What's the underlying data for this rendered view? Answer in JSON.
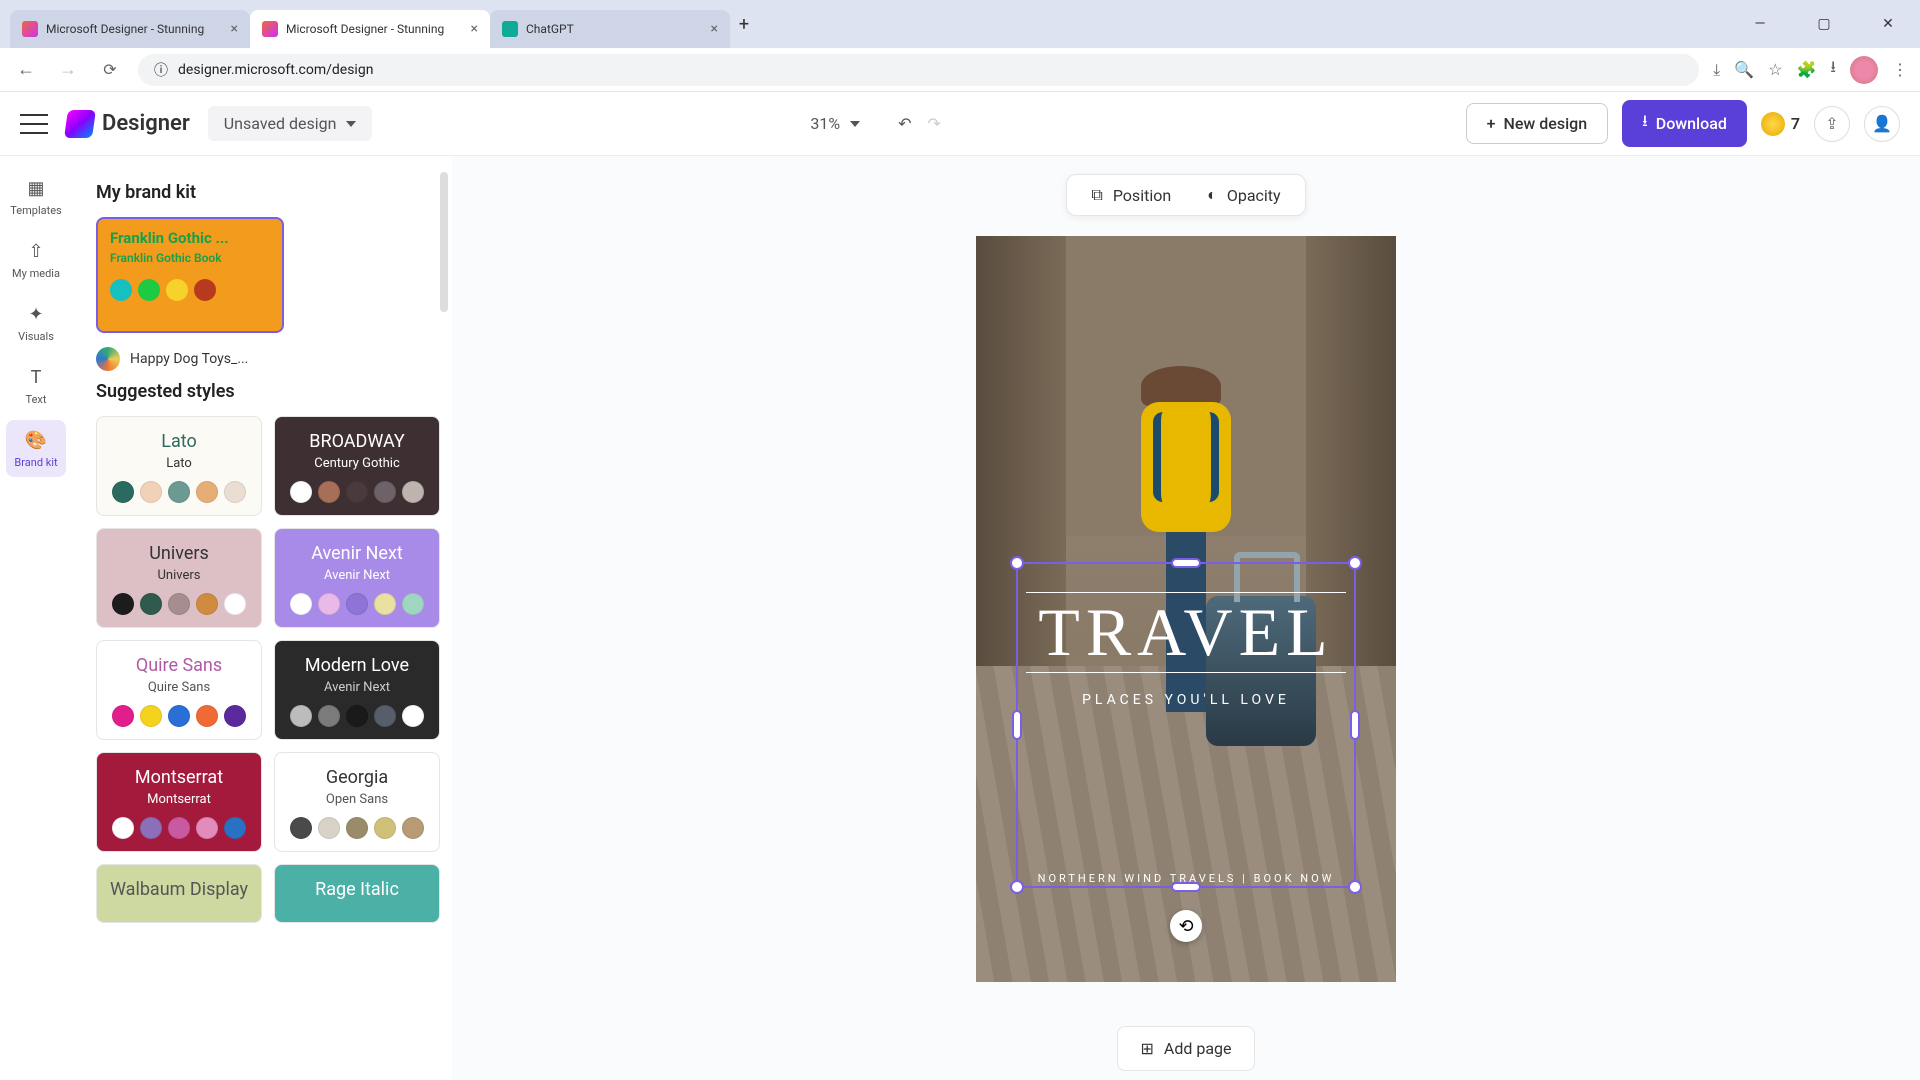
{
  "browser": {
    "tabs": [
      {
        "title": "Microsoft Designer - Stunning"
      },
      {
        "title": "Microsoft Designer - Stunning"
      },
      {
        "title": "ChatGPT"
      }
    ],
    "url": "designer.microsoft.com/design"
  },
  "header": {
    "app_name": "Designer",
    "design_name": "Unsaved design",
    "zoom": "31%",
    "new_design": "New design",
    "download": "Download",
    "credits": "7"
  },
  "rail": {
    "templates": "Templates",
    "my_media": "My media",
    "visuals": "Visuals",
    "text": "Text",
    "brand_kit": "Brand kit"
  },
  "panel": {
    "brandkit_heading": "My brand kit",
    "brandkit_card_title": "Franklin Gothic ...",
    "brandkit_card_sub": "Franklin Gothic Book",
    "brandkit_colors": [
      "#14c0c0",
      "#1ec943",
      "#f6d22b",
      "#b83a1e"
    ],
    "brandkit_name": "Happy Dog Toys_...",
    "suggested_heading": "Suggested styles",
    "styles": [
      {
        "t1": "Lato",
        "t2": "Lato",
        "bg": "#fcfaf5",
        "fg": "#2b6a5e",
        "f2": "#333",
        "sw": [
          "#2b6a5e",
          "#f1d2b8",
          "#6b9a93",
          "#e7ad76",
          "#e9ded1"
        ]
      },
      {
        "t1": "BROADWAY",
        "t2": "Century Gothic",
        "bg": "#3d2f32",
        "fg": "#fff",
        "f2": "#fff",
        "sw": [
          "#ffffff",
          "#a76f57",
          "#4a3a3d",
          "#6c6267",
          "#beb4af"
        ]
      },
      {
        "t1": "Univers",
        "t2": "Univers",
        "bg": "#ddc0c6",
        "fg": "#333",
        "f2": "#333",
        "sw": [
          "#1c1c1c",
          "#2f5a4d",
          "#a68e8f",
          "#cf8b3f",
          "#ffffff"
        ]
      },
      {
        "t1": "Avenir Next",
        "t2": "Avenir Next",
        "bg": "#a88be8",
        "fg": "#fff",
        "f2": "#fff",
        "sw": [
          "#ffffff",
          "#e9b9e8",
          "#8e74d7",
          "#e9e0a2",
          "#a0d6c1"
        ]
      },
      {
        "t1": "Quire Sans",
        "t2": "Quire Sans",
        "bg": "#ffffff",
        "fg": "#b05aa6",
        "f2": "#555",
        "sw": [
          "#e11e8c",
          "#f4d21e",
          "#2a6fd6",
          "#ef6a35",
          "#5a2a9c"
        ]
      },
      {
        "t1": "Modern Love",
        "t2": "Avenir Next",
        "bg": "#2a2a2a",
        "fg": "#fff",
        "f2": "#ccc",
        "sw": [
          "#bcbcbc",
          "#7b7b7b",
          "#1a1a1a",
          "#575d6b",
          "#ffffff"
        ]
      },
      {
        "t1": "Montserrat",
        "t2": "Montserrat",
        "bg": "#a41a3c",
        "fg": "#fff",
        "f2": "#fff",
        "sw": [
          "#ffffff",
          "#8b6fb8",
          "#c95aa1",
          "#e38bbd",
          "#2a71c4"
        ]
      },
      {
        "t1": "Georgia",
        "t2": "Open Sans",
        "bg": "#ffffff",
        "fg": "#333",
        "f2": "#555",
        "sw": [
          "#4a4a4a",
          "#d8d3c6",
          "#9a8c6a",
          "#cfc07a",
          "#b89a74"
        ]
      },
      {
        "t1": "Walbaum Display",
        "t2": "",
        "bg": "#cdd9a0",
        "fg": "#555",
        "f2": "#555",
        "sw": []
      },
      {
        "t1": "Rage Italic",
        "t2": "",
        "bg": "#4bb0a6",
        "fg": "#fff",
        "f2": "#fff",
        "sw": []
      }
    ]
  },
  "toolbar": {
    "position": "Position",
    "opacity": "Opacity"
  },
  "canvas": {
    "heading": "TRAVEL",
    "subheading": "PLACES YOU'LL LOVE",
    "footer": "NORTHERN WIND TRAVELS | BOOK NOW"
  },
  "add_page": "Add page"
}
